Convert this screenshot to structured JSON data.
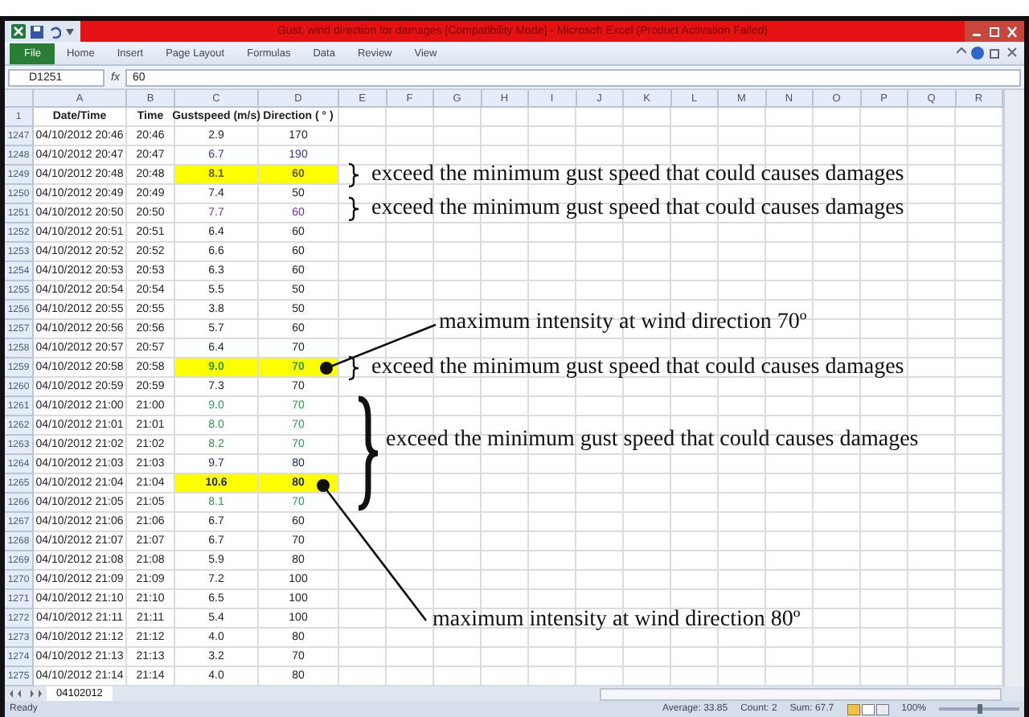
{
  "window": {
    "title": "Gust, wind direction for damages [Compatibility Mode] - Microsoft Excel (Product Activation Failed)"
  },
  "ribbon": {
    "file_button": "File",
    "tabs": [
      "Home",
      "Insert",
      "Page Layout",
      "Formulas",
      "Data",
      "Review",
      "View"
    ]
  },
  "formula_bar": {
    "name_box": "D1251",
    "fx": "fx",
    "value": "60"
  },
  "columns": [
    "A",
    "B",
    "C",
    "D",
    "E",
    "F",
    "G",
    "H",
    "I",
    "J",
    "K",
    "L",
    "M",
    "N",
    "O",
    "P",
    "Q",
    "R"
  ],
  "header_row": {
    "row": "1",
    "cells": [
      "Date/Time",
      "Time",
      "Gustspeed (m/s)",
      "Direction ( ° )"
    ]
  },
  "rows": [
    {
      "row": "1247",
      "date": "04/10/2012 20:46",
      "time": "20:46",
      "gust": "2.9",
      "direction": "170",
      "highlighted": false,
      "color": "#222222"
    },
    {
      "row": "1248",
      "date": "04/10/2012 20:47",
      "time": "20:47",
      "gust": "6.7",
      "direction": "190",
      "highlighted": false,
      "color": "#33339a"
    },
    {
      "row": "1249",
      "date": "04/10/2012 20:48",
      "time": "20:48",
      "gust": "8.1",
      "direction": "60",
      "highlighted": true,
      "color": "#6b5a1a"
    },
    {
      "row": "1250",
      "date": "04/10/2012 20:49",
      "time": "20:49",
      "gust": "7.4",
      "direction": "50",
      "highlighted": false,
      "color": "#222222"
    },
    {
      "row": "1251",
      "date": "04/10/2012 20:50",
      "time": "20:50",
      "gust": "7.7",
      "direction": "60",
      "highlighted": false,
      "color": "#7030a0"
    },
    {
      "row": "1252",
      "date": "04/10/2012 20:51",
      "time": "20:51",
      "gust": "6.4",
      "direction": "60",
      "highlighted": false,
      "color": "#222222"
    },
    {
      "row": "1253",
      "date": "04/10/2012 20:52",
      "time": "20:52",
      "gust": "6.6",
      "direction": "60",
      "highlighted": false,
      "color": "#222222"
    },
    {
      "row": "1254",
      "date": "04/10/2012 20:53",
      "time": "20:53",
      "gust": "6.3",
      "direction": "60",
      "highlighted": false,
      "color": "#222222"
    },
    {
      "row": "1255",
      "date": "04/10/2012 20:54",
      "time": "20:54",
      "gust": "5.5",
      "direction": "50",
      "highlighted": false,
      "color": "#222222"
    },
    {
      "row": "1256",
      "date": "04/10/2012 20:55",
      "time": "20:55",
      "gust": "3.8",
      "direction": "50",
      "highlighted": false,
      "color": "#222222"
    },
    {
      "row": "1257",
      "date": "04/10/2012 20:56",
      "time": "20:56",
      "gust": "5.7",
      "direction": "60",
      "highlighted": false,
      "color": "#222222"
    },
    {
      "row": "1258",
      "date": "04/10/2012 20:57",
      "time": "20:57",
      "gust": "6.4",
      "direction": "70",
      "highlighted": false,
      "color": "#222222"
    },
    {
      "row": "1259",
      "date": "04/10/2012 20:58",
      "time": "20:58",
      "gust": "9.0",
      "direction": "70",
      "highlighted": true,
      "color": "#2e9a50"
    },
    {
      "row": "1260",
      "date": "04/10/2012 20:59",
      "time": "20:59",
      "gust": "7.3",
      "direction": "70",
      "highlighted": false,
      "color": "#222222"
    },
    {
      "row": "1261",
      "date": "04/10/2012 21:00",
      "time": "21:00",
      "gust": "9.0",
      "direction": "70",
      "highlighted": false,
      "color": "#2e9a50"
    },
    {
      "row": "1262",
      "date": "04/10/2012 21:01",
      "time": "21:01",
      "gust": "8.0",
      "direction": "70",
      "highlighted": false,
      "color": "#2e9a50"
    },
    {
      "row": "1263",
      "date": "04/10/2012 21:02",
      "time": "21:02",
      "gust": "8.2",
      "direction": "70",
      "highlighted": false,
      "color": "#2e9a50"
    },
    {
      "row": "1264",
      "date": "04/10/2012 21:03",
      "time": "21:03",
      "gust": "9.7",
      "direction": "80",
      "highlighted": false,
      "color": "#1f2a60"
    },
    {
      "row": "1265",
      "date": "04/10/2012 21:04",
      "time": "21:04",
      "gust": "10.6",
      "direction": "80",
      "highlighted": true,
      "color": "#1f2a60"
    },
    {
      "row": "1266",
      "date": "04/10/2012 21:05",
      "time": "21:05",
      "gust": "8.1",
      "direction": "70",
      "highlighted": false,
      "color": "#2e9a50"
    },
    {
      "row": "1267",
      "date": "04/10/2012 21:06",
      "time": "21:06",
      "gust": "6.7",
      "direction": "60",
      "highlighted": false,
      "color": "#222222"
    },
    {
      "row": "1268",
      "date": "04/10/2012 21:07",
      "time": "21:07",
      "gust": "6.7",
      "direction": "70",
      "highlighted": false,
      "color": "#222222"
    },
    {
      "row": "1269",
      "date": "04/10/2012 21:08",
      "time": "21:08",
      "gust": "5.9",
      "direction": "80",
      "highlighted": false,
      "color": "#222222"
    },
    {
      "row": "1270",
      "date": "04/10/2012 21:09",
      "time": "21:09",
      "gust": "7.2",
      "direction": "100",
      "highlighted": false,
      "color": "#222222"
    },
    {
      "row": "1271",
      "date": "04/10/2012 21:10",
      "time": "21:10",
      "gust": "6.5",
      "direction": "100",
      "highlighted": false,
      "color": "#222222"
    },
    {
      "row": "1272",
      "date": "04/10/2012 21:11",
      "time": "21:11",
      "gust": "5.4",
      "direction": "100",
      "highlighted": false,
      "color": "#222222"
    },
    {
      "row": "1273",
      "date": "04/10/2012 21:12",
      "time": "21:12",
      "gust": "4.0",
      "direction": "80",
      "highlighted": false,
      "color": "#222222"
    },
    {
      "row": "1274",
      "date": "04/10/2012 21:13",
      "time": "21:13",
      "gust": "3.2",
      "direction": "70",
      "highlighted": false,
      "color": "#222222"
    },
    {
      "row": "1275",
      "date": "04/10/2012 21:14",
      "time": "21:14",
      "gust": "4.0",
      "direction": "80",
      "highlighted": false,
      "color": "#222222"
    }
  ],
  "annotations": [
    {
      "kind": "brace",
      "text": "exceed the minimum gust speed that could causes damages"
    },
    {
      "kind": "brace",
      "text": "exceed the minimum gust speed that could causes damages"
    },
    {
      "kind": "pointer",
      "text": "maximum intensity at wind direction 70º"
    },
    {
      "kind": "brace",
      "text": "exceed the minimum gust speed that could causes damages"
    },
    {
      "kind": "big_brace",
      "text": "exceed the minimum gust speed that could causes damages"
    },
    {
      "kind": "pointer",
      "text": "maximum intensity at wind direction 80º"
    }
  ],
  "sheet_tabs": [
    {
      "label": "04102012",
      "selected": true
    }
  ],
  "status_bar": {
    "mode": "Ready",
    "average": "Average: 33.85",
    "count": "Count: 2",
    "sum": "Sum: 67.7",
    "zoom": "100%",
    "zoom_slider": {
      "level": 0.5
    }
  }
}
